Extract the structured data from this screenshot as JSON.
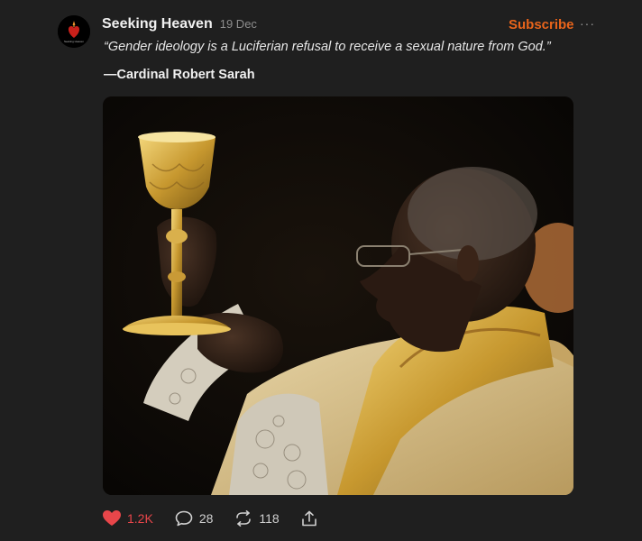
{
  "post": {
    "author": "Seeking Heaven",
    "avatar_caption": "Seeking Heaven",
    "date": "19 Dec",
    "subscribe_label": "Subscribe",
    "more_label": "···",
    "quote": "“Gender ideology is a Luciferian refusal to receive a sexual nature from God.”",
    "attribution": "—Cardinal Robert Sarah",
    "image_icon": "photo-of-cardinal-elevating-chalice"
  },
  "actions": {
    "likes": "1.2K",
    "comments": "28",
    "restacks": "118",
    "like_icon": "heart-icon",
    "comment_icon": "comment-icon",
    "restack_icon": "restack-icon",
    "share_icon": "share-icon"
  },
  "colors": {
    "background": "#1f1f1f",
    "accent": "#e8641b",
    "liked": "#e8464a",
    "muted": "#8d8d8d"
  }
}
